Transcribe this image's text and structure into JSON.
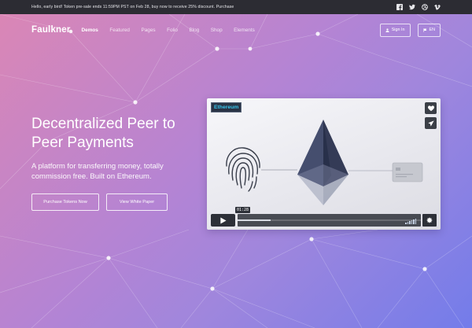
{
  "announcement": {
    "text": "Hello, early bird! Token pre-sale ends 11:59PM PST on Feb 28, buy now to receive 25% discount. Purchase"
  },
  "social": [
    "facebook-icon",
    "twitter-icon",
    "dribbble-icon",
    "vimeo-icon"
  ],
  "nav": {
    "brand": "Faulkner",
    "links": [
      "Demos",
      "Featured",
      "Pages",
      "Folio",
      "Blog",
      "Shop",
      "Elements"
    ],
    "active": "Demos",
    "sign_in": "Sign In",
    "language": "EN"
  },
  "hero": {
    "title": "Decentralized Peer to Peer Payments",
    "subtitle": "A platform for transferring money, totally commission free. Built on Ethereum.",
    "cta_primary": "Purchase Tokens Now",
    "cta_secondary": "View White Paper"
  },
  "video": {
    "badge": "Ethereum",
    "time": "01:28",
    "progress": 0.18
  },
  "colors": {
    "topbar": "#2c2c33",
    "gradient_start": "#dc86b4",
    "gradient_end": "#737cea",
    "badge_text": "#38c4ea"
  }
}
